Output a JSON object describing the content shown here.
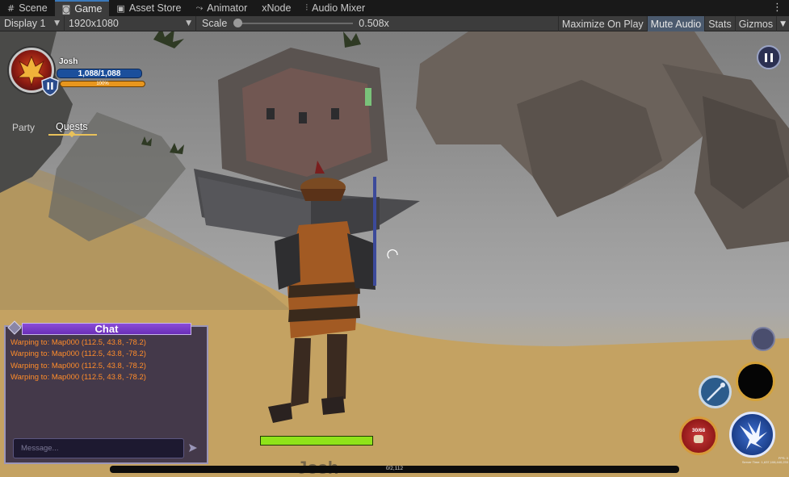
{
  "editor": {
    "tabs": [
      {
        "label": "Scene",
        "icon": "grid-icon"
      },
      {
        "label": "Game",
        "icon": "gamepad-icon"
      },
      {
        "label": "Asset Store",
        "icon": "bag-icon"
      },
      {
        "label": "Animator",
        "icon": "animator-icon"
      },
      {
        "label": "xNode",
        "icon": ""
      },
      {
        "label": "Audio Mixer",
        "icon": "mixer-icon"
      }
    ],
    "active_tab": "Game",
    "toolbar": {
      "display": "Display 1",
      "resolution": "1920x1080",
      "scale_label": "Scale",
      "scale_value": "0.508x",
      "maximize_on_play": "Maximize On Play",
      "mute_audio": "Mute Audio",
      "stats": "Stats",
      "gizmos": "Gizmos"
    }
  },
  "hud": {
    "player": {
      "name": "Josh",
      "hp": "1,088/1,088",
      "xp": "100%"
    },
    "tabs": {
      "party": "Party",
      "quests": "Quests"
    },
    "chat": {
      "title": "Chat",
      "lines": [
        "Warping to: Map000 (112.5, 43.8, -78.2)",
        "Warping to: Map000 (112.5, 43.8, -78.2)",
        "Warping to: Map000 (112.5, 43.8, -78.2)",
        "Warping to: Map000 (112.5, 43.8, -78.2)"
      ],
      "placeholder": "Message..."
    },
    "bottom": {
      "xp_text": "0/2,112",
      "nameplate": "Josh"
    },
    "skills": {
      "potion_count": "30/68"
    },
    "tiny_info": [
      "FPS: 0",
      "Server Time: 1,637,108,440,233"
    ]
  },
  "colors": {
    "hp": "#1b4f9c",
    "xp": "#e8961e",
    "health": "#8fe31a",
    "chat_text": "#ff8c2a"
  }
}
